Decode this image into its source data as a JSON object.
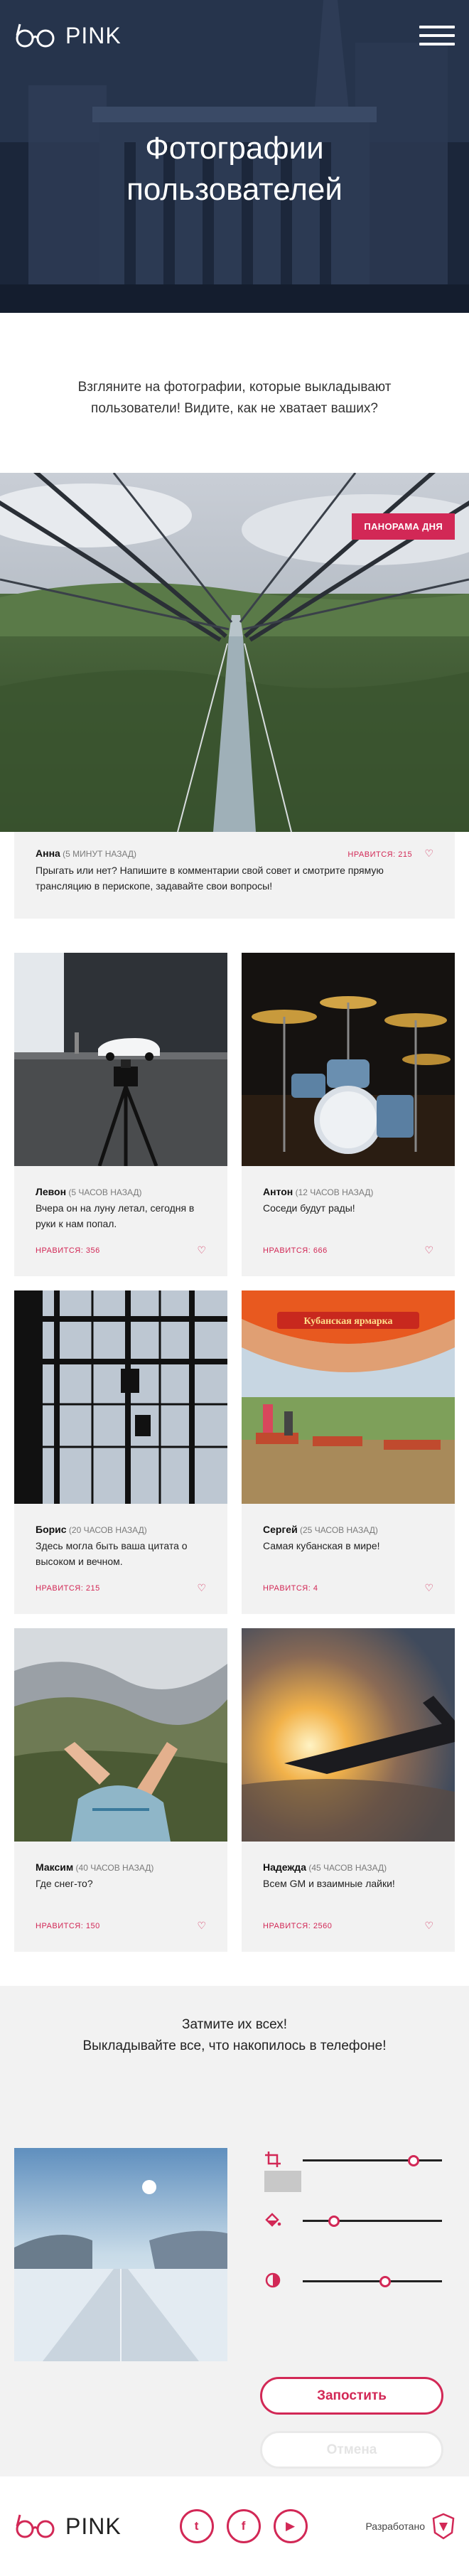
{
  "header": {
    "logo_text": "PINK",
    "menu_icon": "hamburger-icon"
  },
  "hero": {
    "title_line1": "Фотографии",
    "title_line2": "пользователей"
  },
  "intro": {
    "text": "Взгляните на фотографии, которые выкладывают пользователи! Видите, как не хватает ваших?"
  },
  "panorama": {
    "badge": "ПАНОРАМА ДНЯ",
    "author": "Анна",
    "time": "(5 МИНУТ НАЗАД)",
    "likes": "НРАВИТСЯ: 215",
    "text": "Прыгать или нет? Напишите в комментарии свой совет и смотрите прямую трансляцию в перископе, задавайте свои вопросы!"
  },
  "posts": [
    {
      "author": "Левон",
      "time": "(5 ЧАСОВ НАЗАД)",
      "text": "Вчера он на луну летал, сегодня в руки к нам попал.",
      "likes": "НРАВИТСЯ: 356"
    },
    {
      "author": "Антон",
      "time": "(12 ЧАСОВ НАЗАД)",
      "text": "Соседи будут рады!",
      "likes": "НРАВИТСЯ: 666"
    },
    {
      "author": "Борис",
      "time": "(20 ЧАСОВ НАЗАД)",
      "text": "Здесь могла быть ваша цитата о высоком и вечном.",
      "likes": "НРАВИТСЯ: 215"
    },
    {
      "author": "Сергей",
      "time": "(25 ЧАСОВ НАЗАД)",
      "text": "Самая кубанская в мире!",
      "likes": "НРАВИТСЯ: 4"
    },
    {
      "author": "Максим",
      "time": "(40 ЧАСОВ НАЗАД)",
      "text": "Где снег-то?",
      "likes": "НРАВИТСЯ: 150"
    },
    {
      "author": "Надежда",
      "time": "(45 ЧАСОВ НАЗАД)",
      "text": "Всем GM и взаимные лайки!",
      "likes": "НРАВИТСЯ: 2560"
    }
  ],
  "market_sign": "Кубанская ярмарка",
  "upload": {
    "line1": "Затмите их всех!",
    "line2": "Выкладывайте все, что накопилось в телефоне!",
    "sliders": [
      {
        "icon": "crop-icon",
        "value": 0.82
      },
      {
        "icon": "fill-icon",
        "value": 0.2
      },
      {
        "icon": "contrast-icon",
        "value": 0.6
      }
    ],
    "submit_label": "Запостить",
    "cancel_label": "Отмена"
  },
  "footer": {
    "logo_text": "PINK",
    "socials": [
      {
        "label": "t",
        "icon": "twitter-icon"
      },
      {
        "label": "f",
        "icon": "facebook-icon"
      },
      {
        "label": "▶",
        "icon": "youtube-icon"
      }
    ],
    "made_by": "Разработано"
  },
  "colors": {
    "accent": "#d22856",
    "dark": "#1d2a40",
    "card": "#f2f2f2"
  }
}
